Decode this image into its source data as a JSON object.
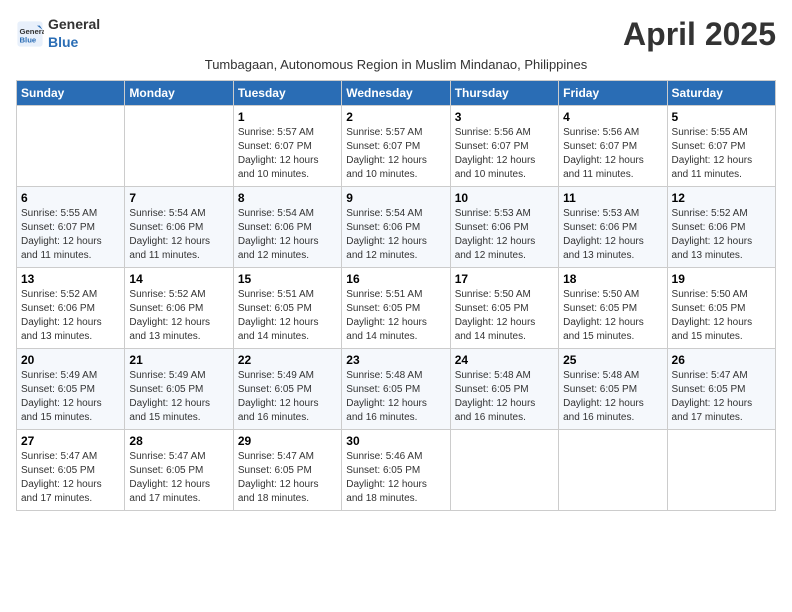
{
  "header": {
    "logo_general": "General",
    "logo_blue": "Blue",
    "title": "April 2025",
    "subtitle": "Tumbagaan, Autonomous Region in Muslim Mindanao, Philippines"
  },
  "weekdays": [
    "Sunday",
    "Monday",
    "Tuesday",
    "Wednesday",
    "Thursday",
    "Friday",
    "Saturday"
  ],
  "weeks": [
    [
      {
        "day": "",
        "info": ""
      },
      {
        "day": "",
        "info": ""
      },
      {
        "day": "1",
        "info": "Sunrise: 5:57 AM\nSunset: 6:07 PM\nDaylight: 12 hours and 10 minutes."
      },
      {
        "day": "2",
        "info": "Sunrise: 5:57 AM\nSunset: 6:07 PM\nDaylight: 12 hours and 10 minutes."
      },
      {
        "day": "3",
        "info": "Sunrise: 5:56 AM\nSunset: 6:07 PM\nDaylight: 12 hours and 10 minutes."
      },
      {
        "day": "4",
        "info": "Sunrise: 5:56 AM\nSunset: 6:07 PM\nDaylight: 12 hours and 11 minutes."
      },
      {
        "day": "5",
        "info": "Sunrise: 5:55 AM\nSunset: 6:07 PM\nDaylight: 12 hours and 11 minutes."
      }
    ],
    [
      {
        "day": "6",
        "info": "Sunrise: 5:55 AM\nSunset: 6:07 PM\nDaylight: 12 hours and 11 minutes."
      },
      {
        "day": "7",
        "info": "Sunrise: 5:54 AM\nSunset: 6:06 PM\nDaylight: 12 hours and 11 minutes."
      },
      {
        "day": "8",
        "info": "Sunrise: 5:54 AM\nSunset: 6:06 PM\nDaylight: 12 hours and 12 minutes."
      },
      {
        "day": "9",
        "info": "Sunrise: 5:54 AM\nSunset: 6:06 PM\nDaylight: 12 hours and 12 minutes."
      },
      {
        "day": "10",
        "info": "Sunrise: 5:53 AM\nSunset: 6:06 PM\nDaylight: 12 hours and 12 minutes."
      },
      {
        "day": "11",
        "info": "Sunrise: 5:53 AM\nSunset: 6:06 PM\nDaylight: 12 hours and 13 minutes."
      },
      {
        "day": "12",
        "info": "Sunrise: 5:52 AM\nSunset: 6:06 PM\nDaylight: 12 hours and 13 minutes."
      }
    ],
    [
      {
        "day": "13",
        "info": "Sunrise: 5:52 AM\nSunset: 6:06 PM\nDaylight: 12 hours and 13 minutes."
      },
      {
        "day": "14",
        "info": "Sunrise: 5:52 AM\nSunset: 6:06 PM\nDaylight: 12 hours and 13 minutes."
      },
      {
        "day": "15",
        "info": "Sunrise: 5:51 AM\nSunset: 6:05 PM\nDaylight: 12 hours and 14 minutes."
      },
      {
        "day": "16",
        "info": "Sunrise: 5:51 AM\nSunset: 6:05 PM\nDaylight: 12 hours and 14 minutes."
      },
      {
        "day": "17",
        "info": "Sunrise: 5:50 AM\nSunset: 6:05 PM\nDaylight: 12 hours and 14 minutes."
      },
      {
        "day": "18",
        "info": "Sunrise: 5:50 AM\nSunset: 6:05 PM\nDaylight: 12 hours and 15 minutes."
      },
      {
        "day": "19",
        "info": "Sunrise: 5:50 AM\nSunset: 6:05 PM\nDaylight: 12 hours and 15 minutes."
      }
    ],
    [
      {
        "day": "20",
        "info": "Sunrise: 5:49 AM\nSunset: 6:05 PM\nDaylight: 12 hours and 15 minutes."
      },
      {
        "day": "21",
        "info": "Sunrise: 5:49 AM\nSunset: 6:05 PM\nDaylight: 12 hours and 15 minutes."
      },
      {
        "day": "22",
        "info": "Sunrise: 5:49 AM\nSunset: 6:05 PM\nDaylight: 12 hours and 16 minutes."
      },
      {
        "day": "23",
        "info": "Sunrise: 5:48 AM\nSunset: 6:05 PM\nDaylight: 12 hours and 16 minutes."
      },
      {
        "day": "24",
        "info": "Sunrise: 5:48 AM\nSunset: 6:05 PM\nDaylight: 12 hours and 16 minutes."
      },
      {
        "day": "25",
        "info": "Sunrise: 5:48 AM\nSunset: 6:05 PM\nDaylight: 12 hours and 16 minutes."
      },
      {
        "day": "26",
        "info": "Sunrise: 5:47 AM\nSunset: 6:05 PM\nDaylight: 12 hours and 17 minutes."
      }
    ],
    [
      {
        "day": "27",
        "info": "Sunrise: 5:47 AM\nSunset: 6:05 PM\nDaylight: 12 hours and 17 minutes."
      },
      {
        "day": "28",
        "info": "Sunrise: 5:47 AM\nSunset: 6:05 PM\nDaylight: 12 hours and 17 minutes."
      },
      {
        "day": "29",
        "info": "Sunrise: 5:47 AM\nSunset: 6:05 PM\nDaylight: 12 hours and 18 minutes."
      },
      {
        "day": "30",
        "info": "Sunrise: 5:46 AM\nSunset: 6:05 PM\nDaylight: 12 hours and 18 minutes."
      },
      {
        "day": "",
        "info": ""
      },
      {
        "day": "",
        "info": ""
      },
      {
        "day": "",
        "info": ""
      }
    ]
  ]
}
